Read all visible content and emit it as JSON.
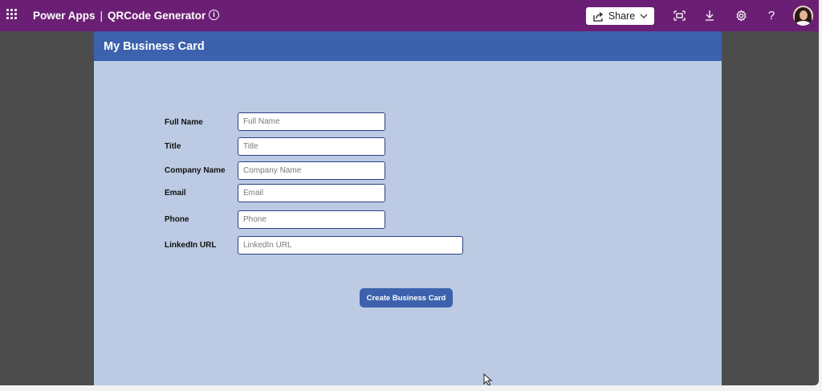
{
  "topbar": {
    "product": "Power Apps",
    "separator": "|",
    "app_name": "QRCode Generator",
    "share_label": "Share",
    "icons": [
      "waffle-icon",
      "info-icon",
      "share-icon",
      "chevron-down-icon",
      "fit-screen-icon",
      "download-icon",
      "gear-icon",
      "help-icon",
      "avatar"
    ],
    "bar_color": "#6b1f74"
  },
  "app": {
    "header_title": "My Business Card",
    "header_color": "#3c62ad",
    "canvas_color": "#bccae3",
    "fields": [
      {
        "label": "Full Name",
        "placeholder": "Full Name",
        "value": ""
      },
      {
        "label": "Title",
        "placeholder": "Title",
        "value": ""
      },
      {
        "label": "Company Name",
        "placeholder": "Company Name",
        "value": ""
      },
      {
        "label": "Email",
        "placeholder": "Email",
        "value": ""
      },
      {
        "label": "Phone",
        "placeholder": "Phone",
        "value": ""
      },
      {
        "label": "LinkedIn URL",
        "placeholder": "LinkedIn URL",
        "value": ""
      }
    ],
    "create_button_label": "Create Business Card"
  }
}
